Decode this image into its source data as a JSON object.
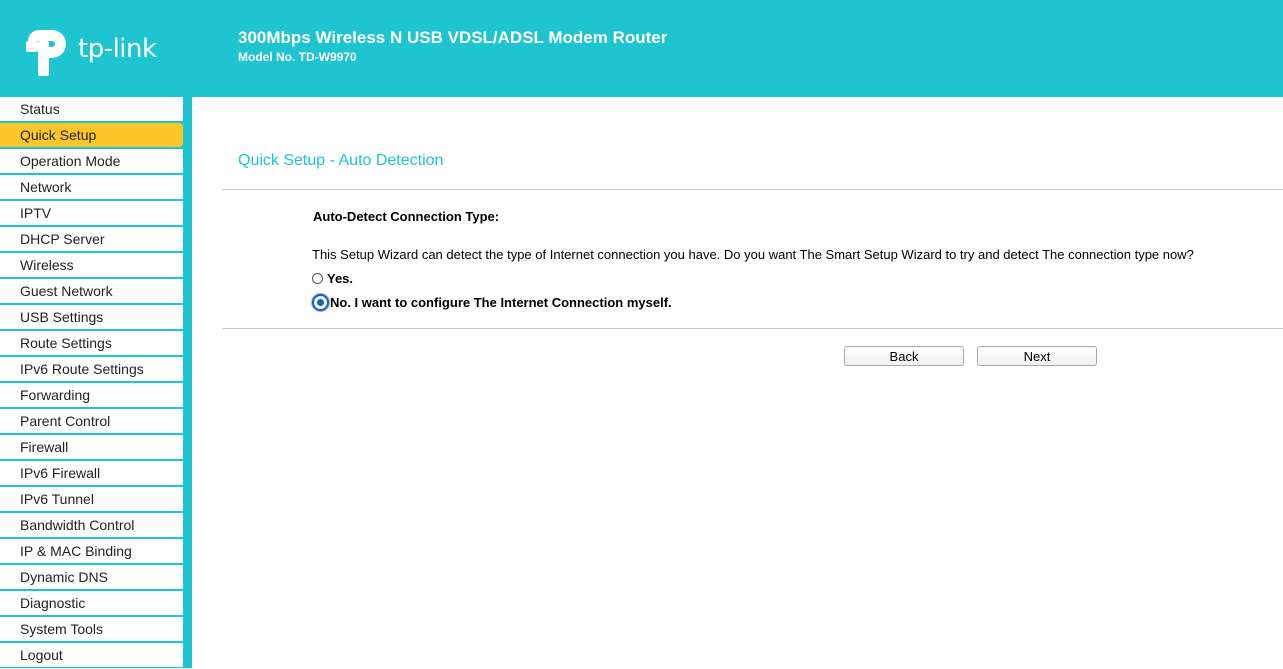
{
  "header": {
    "logo_text": "tp-link",
    "product_title": "300Mbps Wireless N USB VDSL/ADSL Modem Router",
    "model_no": "Model No. TD-W9970"
  },
  "sidebar": {
    "items": [
      {
        "label": "Status"
      },
      {
        "label": "Quick Setup",
        "active": true
      },
      {
        "label": "Operation Mode"
      },
      {
        "label": "Network"
      },
      {
        "label": "IPTV"
      },
      {
        "label": "DHCP Server"
      },
      {
        "label": "Wireless"
      },
      {
        "label": "Guest Network"
      },
      {
        "label": "USB Settings"
      },
      {
        "label": "Route Settings"
      },
      {
        "label": "IPv6 Route Settings"
      },
      {
        "label": "Forwarding"
      },
      {
        "label": "Parent Control"
      },
      {
        "label": "Firewall"
      },
      {
        "label": "IPv6 Firewall"
      },
      {
        "label": "IPv6 Tunnel"
      },
      {
        "label": "Bandwidth Control"
      },
      {
        "label": "IP & MAC Binding"
      },
      {
        "label": "Dynamic DNS"
      },
      {
        "label": "Diagnostic"
      },
      {
        "label": "System Tools"
      },
      {
        "label": "Logout"
      }
    ]
  },
  "main": {
    "page_title": "Quick Setup - Auto Detection",
    "section_title": "Auto-Detect Connection Type:",
    "description": "This Setup Wizard can detect the type of Internet connection you have. Do you want The Smart Setup Wizard to try and detect The connection type now?",
    "options": [
      {
        "label": "Yes.",
        "checked": false
      },
      {
        "label": "No. I want to configure The Internet Connection myself.",
        "checked": true
      }
    ],
    "back_label": "Back",
    "next_label": "Next"
  },
  "colors": {
    "brand": "#1ec4d0",
    "active_menu": "#fdc62b",
    "radio_selected": "#1660c8"
  }
}
